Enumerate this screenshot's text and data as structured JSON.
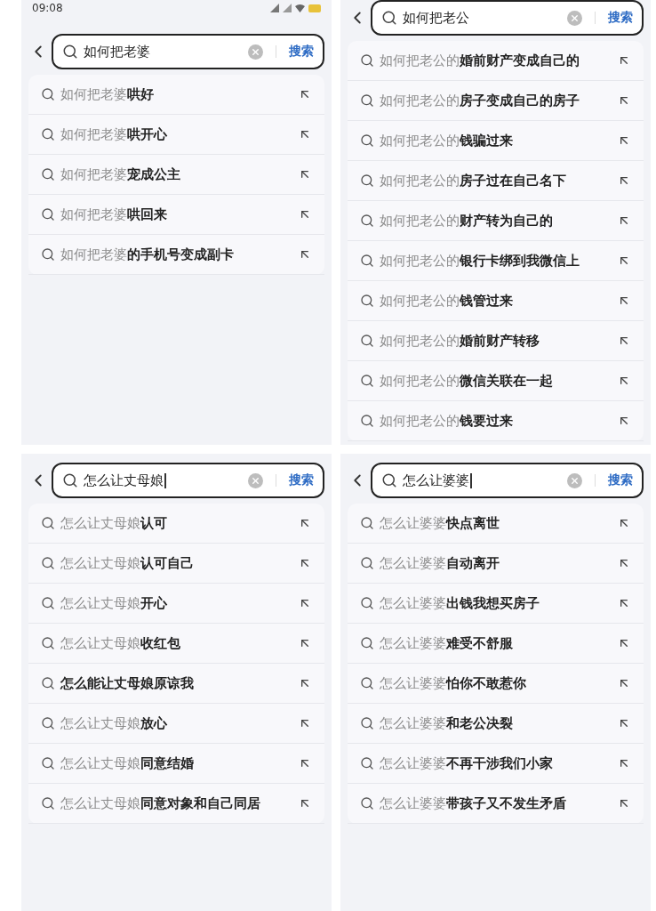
{
  "panels": [
    {
      "status_bar": {
        "time": "09:08"
      },
      "search": {
        "value": "如何把老婆",
        "button": "搜索",
        "focused": false
      },
      "suggestions": [
        {
          "text": "如何把老婆**哄好**",
          "bold": false
        },
        {
          "text": "如何把老婆**哄开心**",
          "bold": false
        },
        {
          "text": "如何把老婆**宠成公主**",
          "bold": false
        },
        {
          "text": "如何把老婆**哄回来**",
          "bold": false
        },
        {
          "text": "如何把老婆**的手机号变成副卡**",
          "bold": false
        }
      ]
    },
    {
      "search": {
        "value": "如何把老公",
        "button": "搜索",
        "focused": false
      },
      "suggestions": [
        {
          "text": "如何把老公的**婚前财产变成自己的**",
          "bold": false
        },
        {
          "text": "如何把老公的**房子变成自己的房子**",
          "bold": false
        },
        {
          "text": "如何把老公的**钱骗过来**",
          "bold": false
        },
        {
          "text": "如何把老公的**房子过在自己名下**",
          "bold": false
        },
        {
          "text": "如何把老公的**财产转为自己的**",
          "bold": false
        },
        {
          "text": "如何把老公的**银行卡绑到我微信上**",
          "bold": false
        },
        {
          "text": "如何把老公的**钱管过来**",
          "bold": false
        },
        {
          "text": "如何把老公的**婚前财产转移**",
          "bold": false
        },
        {
          "text": "如何把老公的**微信关联在一起**",
          "bold": false
        },
        {
          "text": "如何把老公的**钱要过来**",
          "bold": false
        }
      ]
    },
    {
      "search": {
        "value": "怎么让丈母娘",
        "button": "搜索",
        "focused": true
      },
      "suggestions": [
        {
          "text": "怎么让丈母娘**认可**",
          "bold": false
        },
        {
          "text": "怎么让丈母娘**认可自己**",
          "bold": false
        },
        {
          "text": "怎么让丈母娘**开心**",
          "bold": false
        },
        {
          "text": "怎么让丈母娘**收红包**",
          "bold": false
        },
        {
          "text": "怎么能让丈母娘原谅我",
          "bold": true
        },
        {
          "text": "怎么让丈母娘**放心**",
          "bold": false
        },
        {
          "text": "怎么让丈母娘**同意结婚**",
          "bold": false
        },
        {
          "text": "怎么让丈母娘**同意对象和自己同居**",
          "bold": false
        }
      ]
    },
    {
      "search": {
        "value": "怎么让婆婆",
        "button": "搜索",
        "focused": true
      },
      "suggestions": [
        {
          "text": "怎么让婆婆**快点离世**",
          "bold": false
        },
        {
          "text": "怎么让婆婆**自动离开**",
          "bold": false
        },
        {
          "text": "怎么让婆婆**出钱我想买房子**",
          "bold": false
        },
        {
          "text": "怎么让婆婆**难受不舒服**",
          "bold": false
        },
        {
          "text": "怎么让婆婆**怕你不敢惹你**",
          "bold": false
        },
        {
          "text": "怎么让婆婆**和老公决裂**",
          "bold": false
        },
        {
          "text": "怎么让婆婆**不再干涉我们小家**",
          "bold": false
        },
        {
          "text": "怎么让婆婆**带孩子又不发生矛盾**",
          "bold": false
        }
      ]
    }
  ]
}
